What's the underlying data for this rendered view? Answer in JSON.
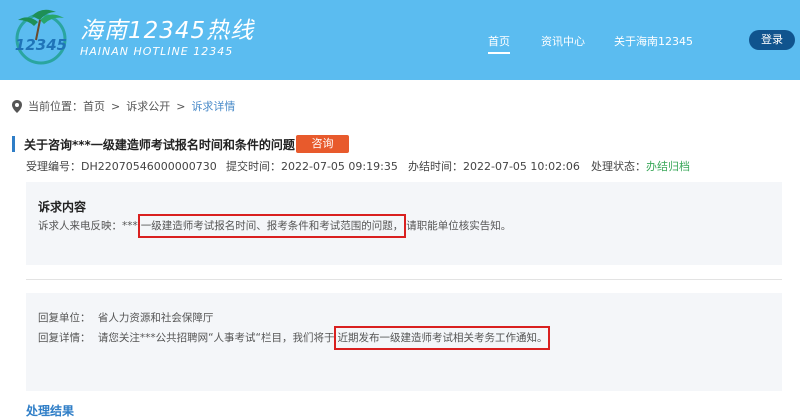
{
  "header": {
    "logo_text": "12345",
    "brand_cn": "海南12345热线",
    "brand_en": "HAINAN HOTLINE 12345",
    "nav": [
      {
        "label": "首页",
        "active": true
      },
      {
        "label": "资讯中心",
        "active": false
      },
      {
        "label": "关于海南12345",
        "active": false
      }
    ],
    "login_label": "登录"
  },
  "breadcrumb": {
    "prefix": "当前位置：",
    "home": "首页",
    "sep1": ">",
    "level2": "诉求公开",
    "sep2": ">",
    "current": "诉求详情"
  },
  "detail": {
    "title": "关于咨询***一级建造师考试报名时间和条件的问题",
    "tag": "咨询",
    "meta": {
      "ticket": "受理编号：DH22070546000000730",
      "submitted": "提交时间：2022-07-05 09:19:35",
      "closed": "办结时间：2022-07-05 10:02:06",
      "status_label": "处理状态：",
      "status_value": "办结归档"
    },
    "request": {
      "heading": "诉求内容",
      "prefix": "诉求人来电反映：***",
      "highlight": "一级建造师考试报名时间、报考条件和考试范围的问题，",
      "suffix": "请职能单位核实告知。"
    },
    "reply": {
      "unit_label": "回复单位：",
      "unit_value": "省人力资源和社会保障厅",
      "detail_label": "回复详情：",
      "detail_prefix": "请您关注***公共招聘网“人事考试“栏目，我们将于",
      "detail_highlight": "近期发布一级建造师考试相关考务工作通知。"
    },
    "footer_partial": "处理结果"
  },
  "colors": {
    "header_bg": "#5bbcf0",
    "login_bg": "#10548e",
    "tag_bg": "#e85a2c",
    "status_green": "#3aa85a",
    "highlight_red": "#d92020"
  }
}
